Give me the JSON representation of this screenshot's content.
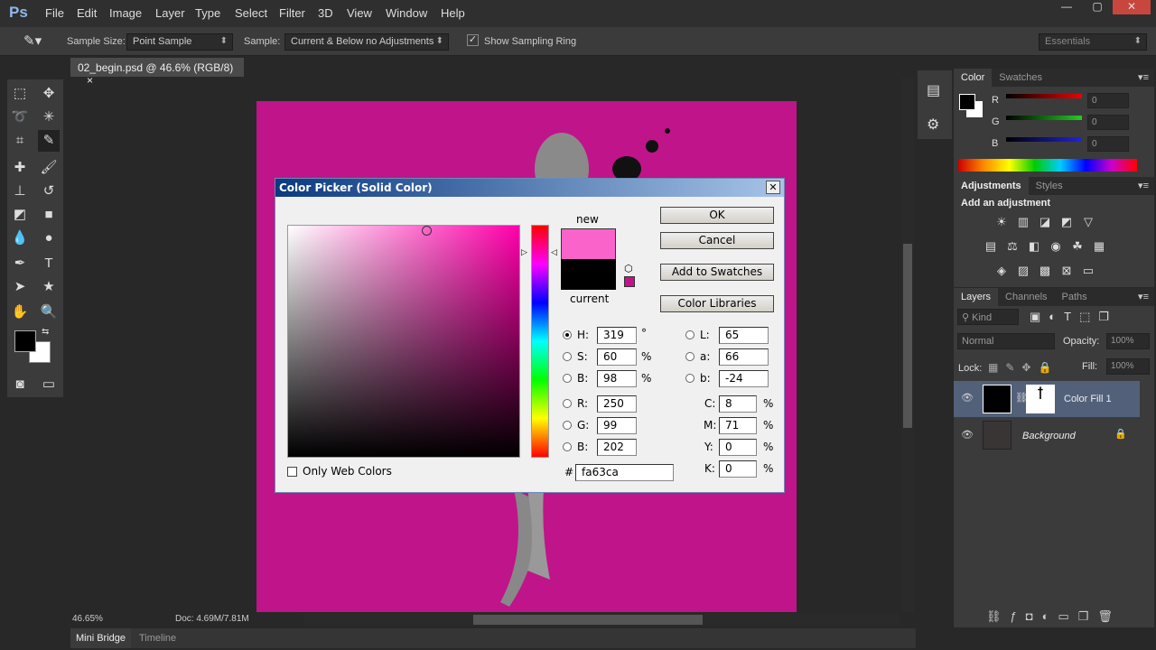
{
  "app": {
    "logo": "Ps",
    "menu": [
      "File",
      "Edit",
      "Image",
      "Layer",
      "Type",
      "Select",
      "Filter",
      "3D",
      "View",
      "Window",
      "Help"
    ],
    "window_controls": [
      "—",
      "▢",
      "✕"
    ]
  },
  "options": {
    "sample_size_label": "Sample Size:",
    "sample_size_value": "Point Sample",
    "sample_label": "Sample:",
    "sample_value": "Current & Below no Adjustments",
    "show_ring_label": "Show Sampling Ring",
    "show_ring_checked": true,
    "workspace": "Essentials"
  },
  "document": {
    "tab_title": "02_begin.psd @ 46.6% (RGB/8)",
    "close": "×",
    "canvas_color": "#c0148a"
  },
  "status": {
    "zoom": "46.65%",
    "doc": "Doc: 4.69M/7.81M"
  },
  "bottom_tabs": [
    "Mini Bridge",
    "Timeline"
  ],
  "color_panel": {
    "tabs": [
      "Color",
      "Swatches"
    ],
    "channels": [
      {
        "label": "R",
        "value": "0"
      },
      {
        "label": "G",
        "value": "0"
      },
      {
        "label": "B",
        "value": "0"
      }
    ]
  },
  "adjustments_panel": {
    "tabs": [
      "Adjustments",
      "Styles"
    ],
    "heading": "Add an adjustment"
  },
  "layers_panel": {
    "tabs": [
      "Layers",
      "Channels",
      "Paths"
    ],
    "filter": "Kind",
    "blend_mode": "Normal",
    "opacity_label": "Opacity:",
    "opacity": "100%",
    "lock_label": "Lock:",
    "fill_label": "Fill:",
    "fill": "100%",
    "layers": [
      {
        "name": "Color Fill 1",
        "selected": true
      },
      {
        "name": "Background",
        "locked": true
      }
    ]
  },
  "color_picker": {
    "title": "Color Picker (Solid Color)",
    "new_label": "new",
    "current_label": "current",
    "new_color": "#fa63ca",
    "current_color": "#000000",
    "buttons": {
      "ok": "OK",
      "cancel": "Cancel",
      "add_swatches": "Add to Swatches",
      "libraries": "Color Libraries"
    },
    "hsb": [
      {
        "label": "H:",
        "value": "319",
        "unit": "°",
        "selected": true
      },
      {
        "label": "S:",
        "value": "60",
        "unit": "%"
      },
      {
        "label": "B:",
        "value": "98",
        "unit": "%"
      }
    ],
    "rgb": [
      {
        "label": "R:",
        "value": "250"
      },
      {
        "label": "G:",
        "value": "99"
      },
      {
        "label": "B:",
        "value": "202"
      }
    ],
    "lab": [
      {
        "label": "L:",
        "value": "65"
      },
      {
        "label": "a:",
        "value": "66"
      },
      {
        "label": "b:",
        "value": "-24"
      }
    ],
    "cmyk": [
      {
        "label": "C:",
        "value": "8",
        "unit": "%"
      },
      {
        "label": "M:",
        "value": "71",
        "unit": "%"
      },
      {
        "label": "Y:",
        "value": "0",
        "unit": "%"
      },
      {
        "label": "K:",
        "value": "0",
        "unit": "%"
      }
    ],
    "hex_label": "#",
    "hex": "fa63ca",
    "web_only_label": "Only Web Colors",
    "hue_color": "#ff00aa"
  }
}
